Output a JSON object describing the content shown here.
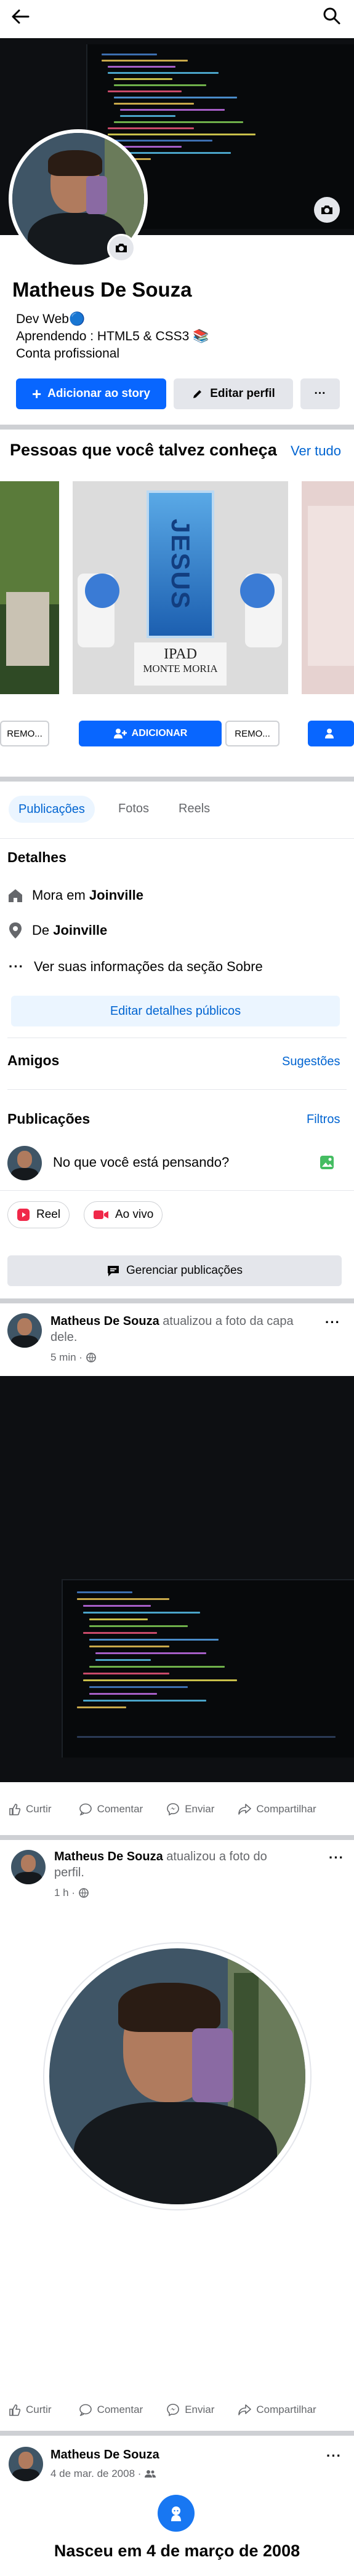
{
  "topbar": {
    "back_icon": "arrow-left-icon",
    "search_icon": "search-icon"
  },
  "profile": {
    "name": "Matheus De Souza",
    "bio": [
      "Dev Web🔵",
      "Aprendendo : HTML5 & CSS3 📚",
      "Conta profissional"
    ],
    "add_story_label": "Adicionar ao story",
    "edit_profile_label": "Editar perfil",
    "more_label": "···"
  },
  "suggestions": {
    "title": "Pessoas que você talvez conheça",
    "see_all": "Ver tudo",
    "card_sign_text": "JESUS",
    "card_caption_1": "IPAD",
    "card_caption_2": "MONTE MORIA",
    "remove_label": "REMO...",
    "add_label": "ADICIONAR"
  },
  "tabs": [
    "Publicações",
    "Fotos",
    "Reels"
  ],
  "details": {
    "title": "Detalhes",
    "lives_prefix": "Mora em ",
    "lives_city": "Joinville",
    "from_prefix": "De ",
    "from_city": "Joinville",
    "about": "Ver suas informações da seção Sobre",
    "edit_button": "Editar detalhes públicos"
  },
  "friends": {
    "title": "Amigos",
    "suggestions_link": "Sugestões"
  },
  "posts_section": {
    "title": "Publicações",
    "filters": "Filtros",
    "composer_placeholder": "No que você está pensando?",
    "reel_label": "Reel",
    "live_label": "Ao vivo",
    "manage_label": "Gerenciar publicações"
  },
  "posts": [
    {
      "author": "Matheus De Souza",
      "action": " atualizou a foto da capa dele.",
      "time": "5 min ·"
    },
    {
      "author": "Matheus De Souza",
      "action": " atualizou a foto do perfil.",
      "time": "1 h ·"
    },
    {
      "author": "Matheus De Souza",
      "action": "",
      "time": "4 de mar. de 2008 ·"
    }
  ],
  "post_actions": {
    "like": "Curtir",
    "comment": "Comentar",
    "send": "Enviar",
    "share": "Compartilhar"
  },
  "life_event": {
    "text": "Nasceu em 4 de março de 2008"
  },
  "colors": {
    "accent": "#0866ff",
    "link": "#0064d1",
    "muted": "#65676b",
    "separator": "#ced0d4"
  }
}
